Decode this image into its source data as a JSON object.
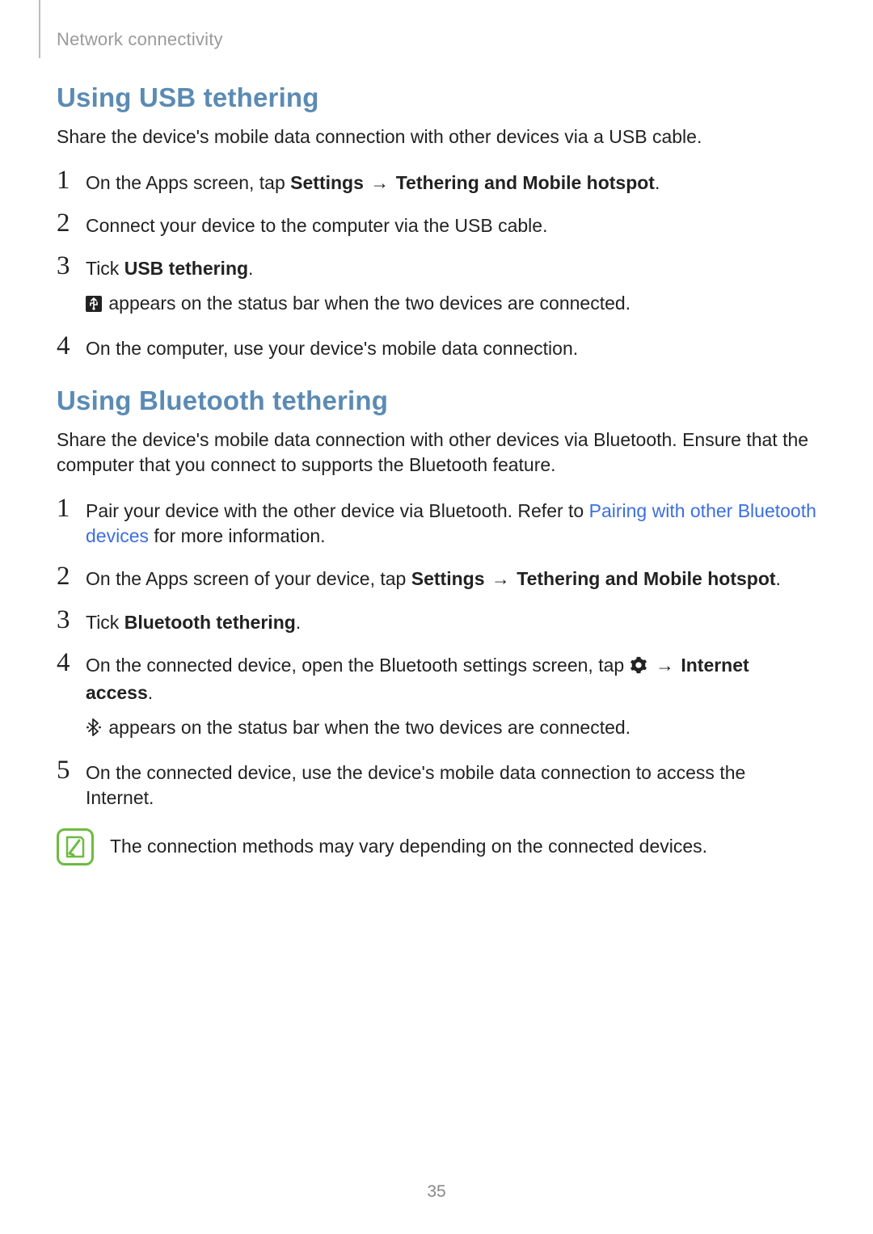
{
  "breadcrumb": "Network connectivity",
  "s1": {
    "heading": "Using USB tethering",
    "lead": "Share the device's mobile data connection with other devices via a USB cable.",
    "steps": [
      {
        "n": "1",
        "pre": "On the Apps screen, tap ",
        "b1": "Settings",
        "arrow": " → ",
        "b2": "Tethering and Mobile hotspot",
        "post": "."
      },
      {
        "n": "2",
        "text": "Connect your device to the computer via the USB cable."
      },
      {
        "n": "3",
        "pre": "Tick ",
        "b1": "USB tethering",
        "post": ".",
        "sub": " appears on the status bar when the two devices are connected."
      },
      {
        "n": "4",
        "text": "On the computer, use your device's mobile data connection."
      }
    ]
  },
  "s2": {
    "heading": "Using Bluetooth tethering",
    "lead": "Share the device's mobile data connection with other devices via Bluetooth. Ensure that the computer that you connect to supports the Bluetooth feature.",
    "steps": [
      {
        "n": "1",
        "pre": "Pair your device with the other device via Bluetooth. Refer to ",
        "link": "Pairing with other Bluetooth devices",
        "post": " for more information."
      },
      {
        "n": "2",
        "pre": "On the Apps screen of your device, tap ",
        "b1": "Settings",
        "arrow": " → ",
        "b2": "Tethering and Mobile hotspot",
        "post": "."
      },
      {
        "n": "3",
        "pre": "Tick ",
        "b1": "Bluetooth tethering",
        "post": "."
      },
      {
        "n": "4",
        "pre": "On the connected device, open the Bluetooth settings screen, tap ",
        "arrow": " → ",
        "b2": "Internet access",
        "post": ".",
        "sub": " appears on the status bar when the two devices are connected."
      },
      {
        "n": "5",
        "text": "On the connected device, use the device's mobile data connection to access the Internet."
      }
    ],
    "note": "The connection methods may vary depending on the connected devices."
  },
  "pagenum": "35",
  "icons": {
    "usb": "usb-tether-icon",
    "gear": "gear-icon",
    "bluetooth": "bluetooth-active-icon",
    "note": "note-icon"
  }
}
